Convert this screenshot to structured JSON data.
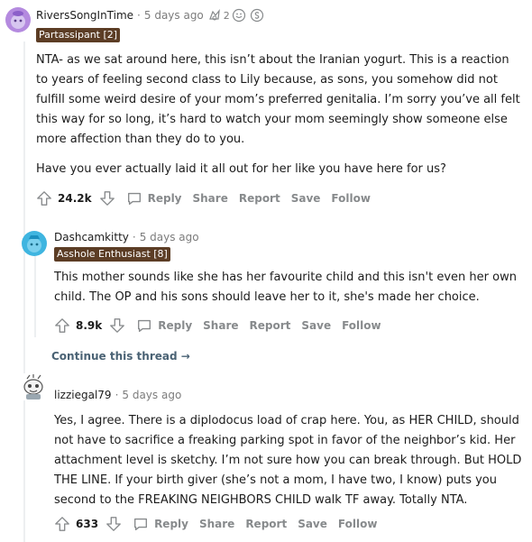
{
  "comments": [
    {
      "username": "RiversSongInTime",
      "time": "5 days ago",
      "award_count": "2",
      "flair": "Partassipant [2]",
      "paragraphs": [
        "NTA- as we sat around here, this isn’t about the Iranian yogurt. This is a reaction to years of feeling second class to Lily because, as sons, you somehow did not fulfill some weird desire of your mom’s preferred genitalia. I’m sorry you’ve all felt this way for so long, it’s hard to watch your mom seemingly show someone else more affection than they do to you.",
        "Have you ever actually laid it all out for her like you have here for us?"
      ],
      "score": "24.2k",
      "actions": {
        "reply": "Reply",
        "share": "Share",
        "report": "Report",
        "save": "Save",
        "follow": "Follow"
      },
      "avatar_color": "#b48adf"
    },
    {
      "username": "Dashcamkitty",
      "time": "5 days ago",
      "flair": "Asshole Enthusiast [8]",
      "paragraphs": [
        "This mother sounds like she has her favourite child and this isn't even her own child. The OP and his sons should leave her to it, she's made her choice."
      ],
      "score": "8.9k",
      "actions": {
        "reply": "Reply",
        "share": "Share",
        "report": "Report",
        "save": "Save",
        "follow": "Follow"
      },
      "avatar_color": "#3fb5e0",
      "continue_label": "Continue this thread →"
    },
    {
      "username": "lizziegal79",
      "time": "5 days ago",
      "paragraphs": [
        "Yes, I agree. There is a diplodocus load of crap here. You, as HER CHILD, should not have to sacrifice a freaking parking spot in favor of the neighbor’s kid. Her attachment level is sketchy. I’m not sure how you can break through. But HOLD THE LINE. If your birth giver (she’s not a mom, I have two, I know) puts you second to the FREAKING NEIGHBORS CHILD walk TF away. Totally NTA."
      ],
      "score": "633",
      "actions": {
        "reply": "Reply",
        "share": "Share",
        "report": "Report",
        "save": "Save",
        "follow": "Follow"
      }
    }
  ],
  "separator": "·"
}
